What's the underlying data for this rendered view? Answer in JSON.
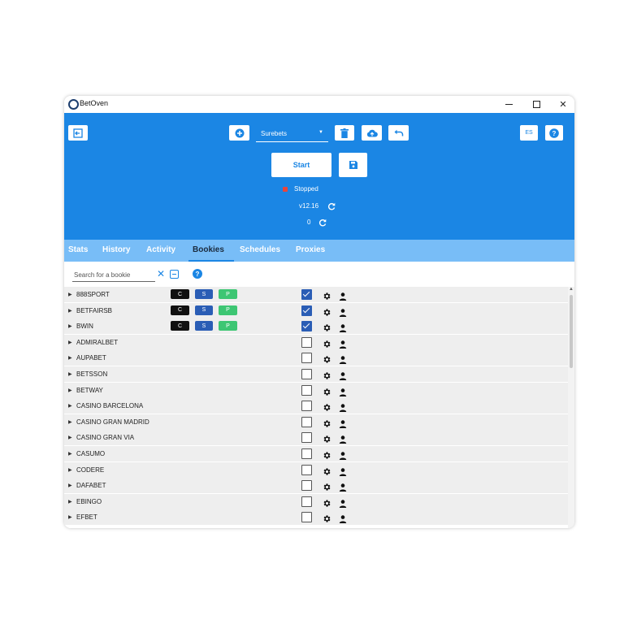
{
  "window": {
    "title": "BetOven"
  },
  "header": {
    "profile_value": "Surebets",
    "start_label": "Start",
    "status": "Stopped",
    "status_color": "#e8453c",
    "version": "v12.16",
    "count": "0",
    "lang_label": "ES",
    "accent_color": "#1b86e4"
  },
  "tabs": [
    {
      "label": "Stats"
    },
    {
      "label": "History"
    },
    {
      "label": "Activity"
    },
    {
      "label": "Bookies",
      "active": true
    },
    {
      "label": "Schedules"
    },
    {
      "label": "Proxies"
    }
  ],
  "search": {
    "placeholder": "Search for a bookie",
    "value": ""
  },
  "badges": {
    "c": "C",
    "s": "S",
    "p": "P"
  },
  "bookies": [
    {
      "name": "888SPORT",
      "badges": true,
      "checked": true
    },
    {
      "name": "BETFAIRSB",
      "badges": true,
      "checked": true
    },
    {
      "name": "BWIN",
      "badges": true,
      "checked": true
    },
    {
      "name": "ADMIRALBET",
      "badges": false,
      "checked": false
    },
    {
      "name": "AUPABET",
      "badges": false,
      "checked": false
    },
    {
      "name": "BETSSON",
      "badges": false,
      "checked": false
    },
    {
      "name": "BETWAY",
      "badges": false,
      "checked": false
    },
    {
      "name": "CASINO BARCELONA",
      "badges": false,
      "checked": false
    },
    {
      "name": "CASINO GRAN MADRID",
      "badges": false,
      "checked": false
    },
    {
      "name": "CASINO GRAN VIA",
      "badges": false,
      "checked": false
    },
    {
      "name": "CASUMO",
      "badges": false,
      "checked": false
    },
    {
      "name": "CODERE",
      "badges": false,
      "checked": false
    },
    {
      "name": "DAFABET",
      "badges": false,
      "checked": false
    },
    {
      "name": "EBINGO",
      "badges": false,
      "checked": false
    },
    {
      "name": "EFBET",
      "badges": false,
      "checked": false
    }
  ],
  "icons": {
    "logout": "logout-icon",
    "add": "plus-circle-icon",
    "delete": "trash-icon",
    "upload": "cloud-upload-icon",
    "undo": "undo-icon",
    "save": "floppy-icon",
    "help": "question-icon",
    "refresh": "refresh-icon",
    "settings": "gear-icon",
    "account": "person-icon"
  }
}
